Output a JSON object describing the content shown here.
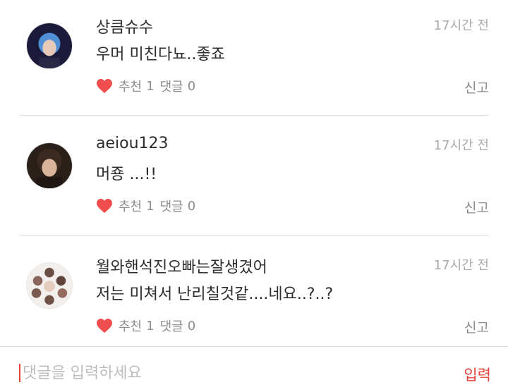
{
  "comments": [
    {
      "author": "상큼슈수",
      "time": "17시간 전",
      "text": "우머 미친다뇨..좋죠",
      "recommend_label": "추천",
      "recommend_count": "1",
      "reply_label": "댓글",
      "reply_count": "0",
      "report_label": "신고"
    },
    {
      "author": "aeiou123",
      "time": "17시간 전",
      "text": "머죵 ...!!",
      "recommend_label": "추천",
      "recommend_count": "1",
      "reply_label": "댓글",
      "reply_count": "0",
      "report_label": "신고"
    },
    {
      "author": "월와핸석진오빠는잘생겼어",
      "time": "17시간 전",
      "text": "저는 미쳐서 난리칠것같....네요..?..?",
      "recommend_label": "추천",
      "recommend_count": "1",
      "reply_label": "댓글",
      "reply_count": "0",
      "report_label": "신고"
    }
  ],
  "composer": {
    "placeholder": "댓글을 입력하세요",
    "value": "",
    "submit_label": "입력"
  },
  "icons": {
    "like": "heart-icon"
  },
  "colors": {
    "accent": "#e8413a",
    "heart": "#f04e4e",
    "muted_text": "#8c8c8c",
    "timestamp": "#a9a9a9",
    "divider": "#dedede"
  }
}
